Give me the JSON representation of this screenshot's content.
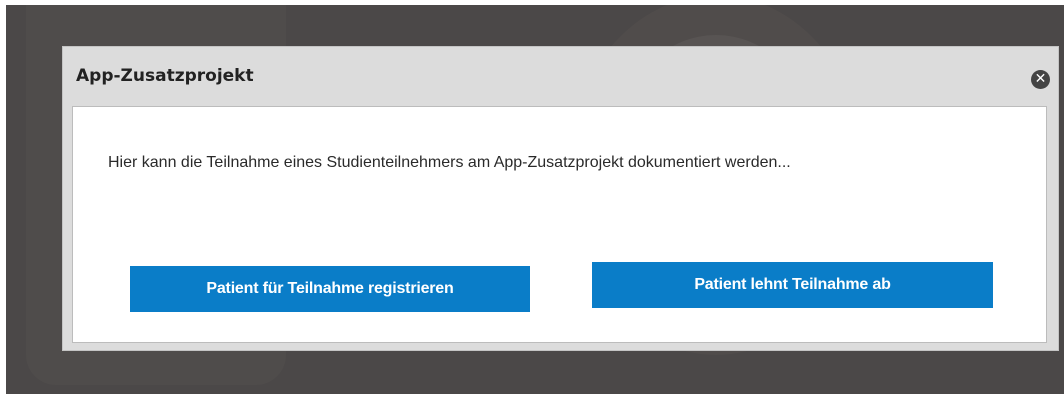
{
  "dialog": {
    "title": "App-Zusatzprojekt",
    "close_icon": "close-circle-icon",
    "close_glyph": "✕",
    "message": "Hier kann die Teilnahme eines Studienteilnehmers am App-Zusatzprojekt dokumentiert werden...",
    "buttons": {
      "register_label": "Patient für Teilnahme registrieren",
      "decline_label": "Patient lehnt Teilnahme ab"
    }
  },
  "colors": {
    "overlay": "#4b4848",
    "dialog_header": "#dcdcdc",
    "button": "#0a7dc8",
    "button_text": "#ffffff"
  }
}
